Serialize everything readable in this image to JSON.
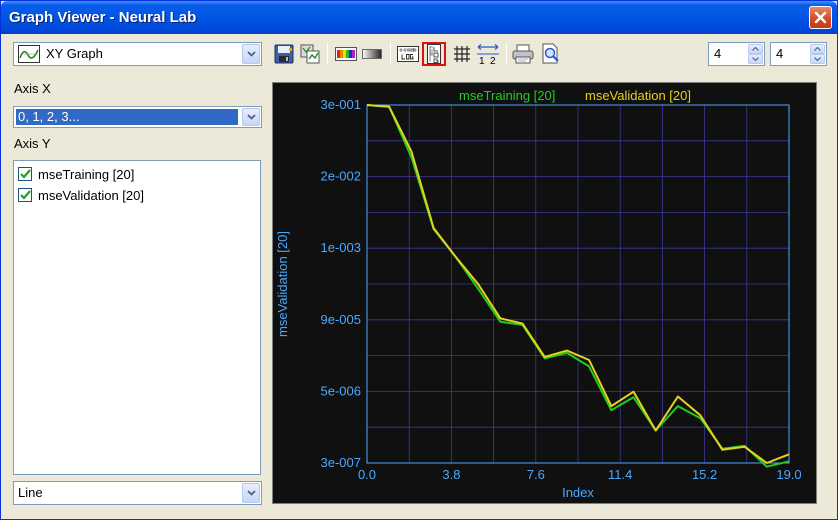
{
  "window": {
    "title": "Graph Viewer - Neural Lab"
  },
  "graph_type": {
    "selected": "XY Graph"
  },
  "axis_x": {
    "label": "Axis X",
    "selected": "0, 1, 2, 3..."
  },
  "axis_y": {
    "label": "Axis Y",
    "items": [
      {
        "label": "mseTraining [20]",
        "checked": true
      },
      {
        "label": "mseValidation [20]",
        "checked": true
      }
    ]
  },
  "line_style": {
    "selected": "Line"
  },
  "spinners": {
    "left": "4",
    "right": "4"
  },
  "toolbar": {
    "icons": [
      "save-icon",
      "copy-icon",
      "color-palette-icon",
      "grayscale-icon",
      "log-scale-icon",
      "log-y-axis-icon",
      "grid-icon",
      "range-icon",
      "print-icon",
      "print-preview-icon"
    ],
    "active": "log-y-axis-icon"
  },
  "colors": {
    "training": "#22cc22",
    "validation": "#e6d21e",
    "axis": "#4aa8ff",
    "plot_bg": "#101010",
    "grid": "#3a3a9a"
  },
  "chart_data": {
    "type": "line",
    "x": [
      0,
      1,
      2,
      3,
      4,
      5,
      6,
      7,
      8,
      9,
      10,
      11,
      12,
      13,
      14,
      15,
      16,
      17,
      18,
      19
    ],
    "series": [
      {
        "name": "mseTraining [20]",
        "values": [
          0.3,
          0.28,
          0.04,
          0.0025,
          0.00085,
          0.00025,
          7e-05,
          6.2e-05,
          1.7e-05,
          2.1e-05,
          1.25e-05,
          2.3e-06,
          3.8e-06,
          1.05e-06,
          2.7e-06,
          1.7e-06,
          5.2e-07,
          5.8e-07,
          2.6e-07,
          3.2e-07
        ]
      },
      {
        "name": "mseValidation [20]",
        "values": [
          0.3,
          0.28,
          0.05,
          0.0026,
          0.00085,
          0.0003,
          8e-05,
          6.5e-05,
          1.8e-05,
          2.3e-05,
          1.6e-05,
          2.7e-06,
          4.7e-06,
          1.05e-06,
          3.9e-06,
          1.9e-06,
          5e-07,
          5.6e-07,
          3e-07,
          4.2e-07
        ]
      }
    ],
    "x_ticks": [
      "0.0",
      "3.8",
      "7.6",
      "11.4",
      "15.2",
      "19.0"
    ],
    "y_ticks": [
      "3e-001",
      "2e-002",
      "1e-003",
      "9e-005",
      "5e-006",
      "3e-007"
    ],
    "xlabel": "Index",
    "ylabel": "mseValidation [20]",
    "xlim": [
      0,
      19
    ],
    "ylim": [
      3e-07,
      0.3
    ],
    "y_scale": "log",
    "grid": true,
    "legend_position": "top-center"
  }
}
